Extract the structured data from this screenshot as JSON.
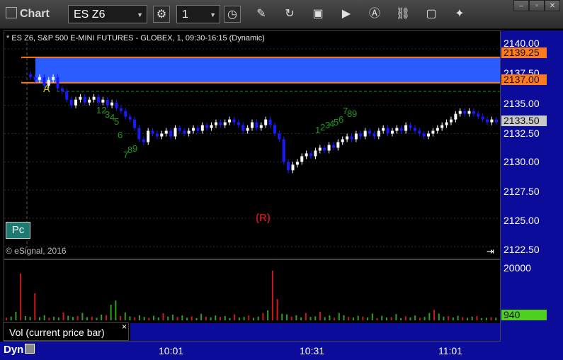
{
  "toolbar": {
    "title": "Chart",
    "symbol": "ES Z6",
    "interval": "1"
  },
  "chart": {
    "title": "* ES Z6, S&P 500 E-MINI FUTURES - GLOBEX, 1, 09:30-16:15 (Dynamic)",
    "copyright": "© eSignal, 2016",
    "pc_label": "Pc",
    "r_label": "(R)",
    "a_label": "A",
    "y_ticks": [
      "2140.00",
      "2137.50",
      "2135.00",
      "2132.50",
      "2130.00",
      "2127.50",
      "2125.00",
      "2122.50"
    ],
    "flags": {
      "upper": "2139.25",
      "lower": "2137.00",
      "last": "2133.50"
    },
    "count_labels": [
      "12",
      "3",
      "4",
      "5",
      "6",
      "7",
      "8",
      "9",
      "1",
      "2",
      "3",
      "4",
      "5",
      "6",
      "7",
      "8",
      "9"
    ],
    "colors": {
      "zone": "#2a5cff",
      "zone_border": "#ff7a1a",
      "up_candle": "#ffffff",
      "down_candle": "#1a1aff",
      "count": "#1f9a1f",
      "axis_bg": "#0c0c9a"
    }
  },
  "volume": {
    "label": "Vol (current price bar)",
    "close": "×",
    "top_tick": "20000",
    "last_flag": "940"
  },
  "bottom": {
    "mode": "Dyn",
    "times": [
      "10:01",
      "10:31",
      "11:01"
    ]
  },
  "chart_data": {
    "type": "candlestick",
    "title": "* ES Z6, S&P 500 E-MINI FUTURES - GLOBEX, 1, 09:30-16:15 (Dynamic)",
    "ylim": [
      2121.5,
      2141.5
    ],
    "x_tick_labels": [
      "10:01",
      "10:31",
      "11:01"
    ],
    "y_tick_labels": [
      "2140.00",
      "2137.50",
      "2135.00",
      "2132.50",
      "2130.00",
      "2127.50",
      "2125.00",
      "2122.50"
    ],
    "zone": {
      "high": 2139.25,
      "low": 2137.0
    },
    "reference_line": 2136.25,
    "last_price": 2133.5,
    "closes": [
      2137.5,
      2137.25,
      2137.5,
      2136.75,
      2137.25,
      2137.5,
      2136.5,
      2136.25,
      2135.5,
      2135.0,
      2135.5,
      2135.75,
      2135.25,
      2135.5,
      2135.75,
      2135.25,
      2135.5,
      2135.0,
      2135.25,
      2134.75,
      2134.5,
      2134.0,
      2133.75,
      2133.0,
      2132.0,
      2131.75,
      2132.75,
      2132.5,
      2132.25,
      2132.5,
      2132.75,
      2132.25,
      2133.0,
      2132.75,
      2132.5,
      2132.75,
      2133.0,
      2132.75,
      2133.25,
      2133.0,
      2133.25,
      2133.5,
      2133.25,
      2133.5,
      2133.75,
      2133.5,
      2133.25,
      2132.75,
      2133.0,
      2133.5,
      2133.0,
      2133.25,
      2133.75,
      2133.25,
      2132.5,
      2132.0,
      2130.0,
      2129.25,
      2129.75,
      2130.0,
      2130.5,
      2130.75,
      2130.5,
      2131.0,
      2131.25,
      2131.0,
      2131.5,
      2131.25,
      2131.75,
      2132.0,
      2132.25,
      2132.0,
      2132.5,
      2132.25,
      2132.75,
      2132.5,
      2132.25,
      2132.75,
      2133.0,
      2132.5,
      2132.75,
      2133.0,
      2132.75,
      2133.25,
      2133.0,
      2132.75,
      2132.5,
      2132.25,
      2132.5,
      2132.75,
      2133.0,
      2133.25,
      2133.5,
      2133.75,
      2134.25,
      2134.5,
      2134.25,
      2134.5,
      2134.25,
      2134.0,
      2133.75,
      2133.5,
      2133.75,
      2133.5
    ],
    "volume_ylim": [
      0,
      20000
    ],
    "volume_last": 940,
    "volume": [
      900,
      1300,
      3000,
      16500,
      1500,
      1200,
      9500,
      1100,
      1800,
      900,
      1300,
      1000,
      2800,
      1600,
      1200,
      1500,
      2600,
      1100,
      1300,
      900,
      2000,
      1800,
      5500,
      7000,
      1500,
      2800,
      1400,
      1100,
      1800,
      1200,
      900,
      1600,
      1000,
      2500,
      1300,
      2000,
      1200,
      1700,
      900,
      1400,
      800,
      2300,
      1300,
      1000,
      1700,
      1200,
      1500,
      800,
      2100,
      1000,
      1200,
      1700,
      900,
      1300,
      2600,
      3500,
      17500,
      7500,
      2300,
      2100,
      1300,
      1800,
      1000,
      2600,
      1200,
      1400,
      3000,
      1100,
      1700,
      900,
      2600,
      1800,
      1200,
      1000,
      1600,
      1300,
      1000,
      2400,
      800,
      1600,
      1000,
      1100,
      2200,
      800,
      1400,
      1000,
      1700,
      900,
      1200,
      2600,
      3700,
      2400,
      1300,
      1500,
      1000,
      1600,
      1100,
      900,
      1300,
      1500,
      800,
      900,
      1100,
      940
    ]
  }
}
